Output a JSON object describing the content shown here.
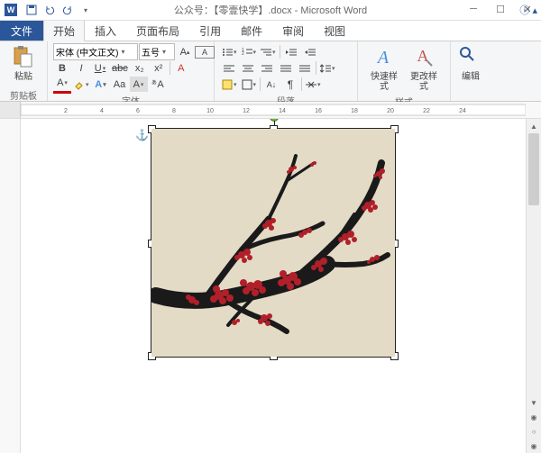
{
  "title": "公众号：【零壹快学】.docx - Microsoft Word",
  "tabs": {
    "file": "文件",
    "items": [
      "开始",
      "插入",
      "页面布局",
      "引用",
      "邮件",
      "审阅",
      "视图"
    ],
    "active": 0
  },
  "ribbon": {
    "clipboard": {
      "label": "剪贴板",
      "paste": "粘贴"
    },
    "font": {
      "label": "字体",
      "family": "宋体 (中文正文)",
      "size": "五号",
      "bold": "B",
      "italic": "I",
      "underline": "U",
      "strike": "abc",
      "sub": "x₂",
      "sup": "x²",
      "clear": "A",
      "phonetic": "A",
      "caseA": "Aa",
      "borderBox": "A"
    },
    "paragraph": {
      "label": "段落"
    },
    "styles": {
      "label": "样式",
      "quick": "快速样式",
      "change": "更改样式"
    },
    "editing": {
      "label": "编辑"
    }
  },
  "image": {
    "description": "Chinese ink painting of plum blossom branch with red flowers on beige background",
    "bg": "#e3dbc6",
    "branch": "#1a1a1a",
    "flower": "#b1202a"
  },
  "colors": {
    "accent": "#2b579a",
    "ribbon": "#f5f6f7"
  }
}
